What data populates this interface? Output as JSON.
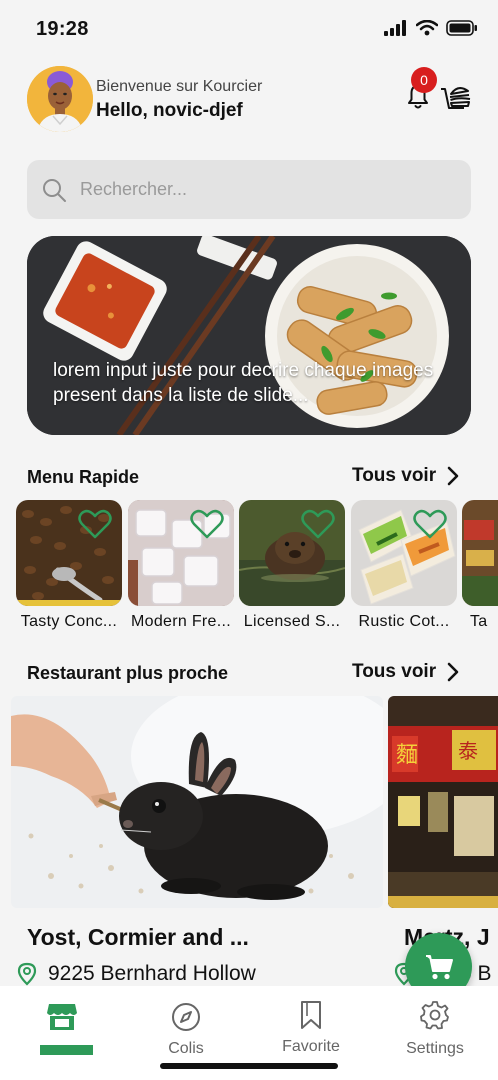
{
  "status_bar": {
    "time": "19:28"
  },
  "header": {
    "welcome": "Bienvenue sur Kourcier",
    "greeting": "Hello, novic-djef",
    "notification_count": "0"
  },
  "search": {
    "placeholder": "Rechercher..."
  },
  "banner": {
    "caption": "lorem input juste pour decrire chaque images present dans la liste de slide..."
  },
  "menu_section": {
    "title": "Menu Rapide",
    "see_all": "Tous voir",
    "items": [
      {
        "label": "Tasty Conc..."
      },
      {
        "label": "Modern Fre..."
      },
      {
        "label": "Licensed S..."
      },
      {
        "label": "Rustic Cot..."
      },
      {
        "label": "Ta"
      }
    ]
  },
  "restaurant_section": {
    "title": "Restaurant plus proche",
    "see_all": "Tous voir",
    "items": [
      {
        "name": "Yost, Cormier and ...",
        "address": "9225 Bernhard Hollow"
      },
      {
        "name": "Mertz, J",
        "address": "2915 B"
      }
    ]
  },
  "tabbar": {
    "tabs": [
      {
        "label": ""
      },
      {
        "label": "Colis"
      },
      {
        "label": "Favorite"
      },
      {
        "label": "Settings"
      }
    ]
  },
  "colors": {
    "accent": "#2e9a58",
    "badge": "#d81e1e"
  },
  "icons": [
    "signal-icon",
    "wifi-icon",
    "battery-icon",
    "bell-icon",
    "burger-cart-icon",
    "search-icon",
    "chevron-right-icon",
    "heart-icon",
    "location-pin-icon",
    "cart-icon",
    "store-icon",
    "compass-icon",
    "bookmark-icon",
    "gear-icon"
  ]
}
